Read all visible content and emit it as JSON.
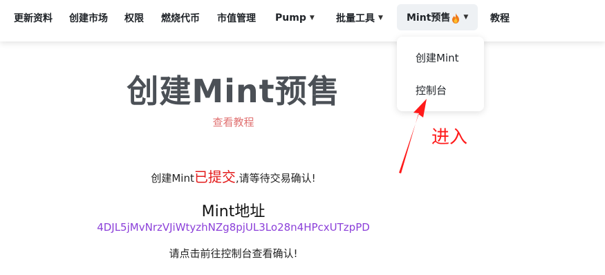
{
  "nav": {
    "items": [
      {
        "label": "更新资料"
      },
      {
        "label": "创建市场"
      },
      {
        "label": "权限"
      },
      {
        "label": "燃烧代币"
      },
      {
        "label": "市值管理"
      },
      {
        "label": "Pump"
      },
      {
        "label": "批量工具"
      },
      {
        "label": "Mint预售"
      },
      {
        "label": "教程"
      }
    ],
    "active_index": 7
  },
  "dropdown": {
    "items": [
      {
        "label": "创建Mint"
      },
      {
        "label": "控制台"
      }
    ]
  },
  "main": {
    "title": "创建Mint预售",
    "tutorial_link": "查看教程",
    "status_prefix": "创建Mint",
    "status_highlight": "已提交",
    "status_suffix": ",请等待交易确认!",
    "address_title": "Mint地址",
    "address_value": "4DJL5jMvNrzVJiWtyzhNZg8pjUL3Lo28n4HPcxUTzpPD",
    "prompt": "请点击前往控制台查看确认!"
  },
  "annotation": {
    "text": "进入"
  },
  "colors": {
    "accent_red": "#e31b1b",
    "link_pink": "#e07070",
    "address_purple": "#8b3fd9",
    "annotation_red": "#ff1a1a",
    "active_bg": "#eef1f4"
  },
  "icons": {
    "dropdown_chevron": "chevron-down-icon",
    "flame": "fire-icon",
    "annotation_arrow": "red-arrow-icon"
  }
}
